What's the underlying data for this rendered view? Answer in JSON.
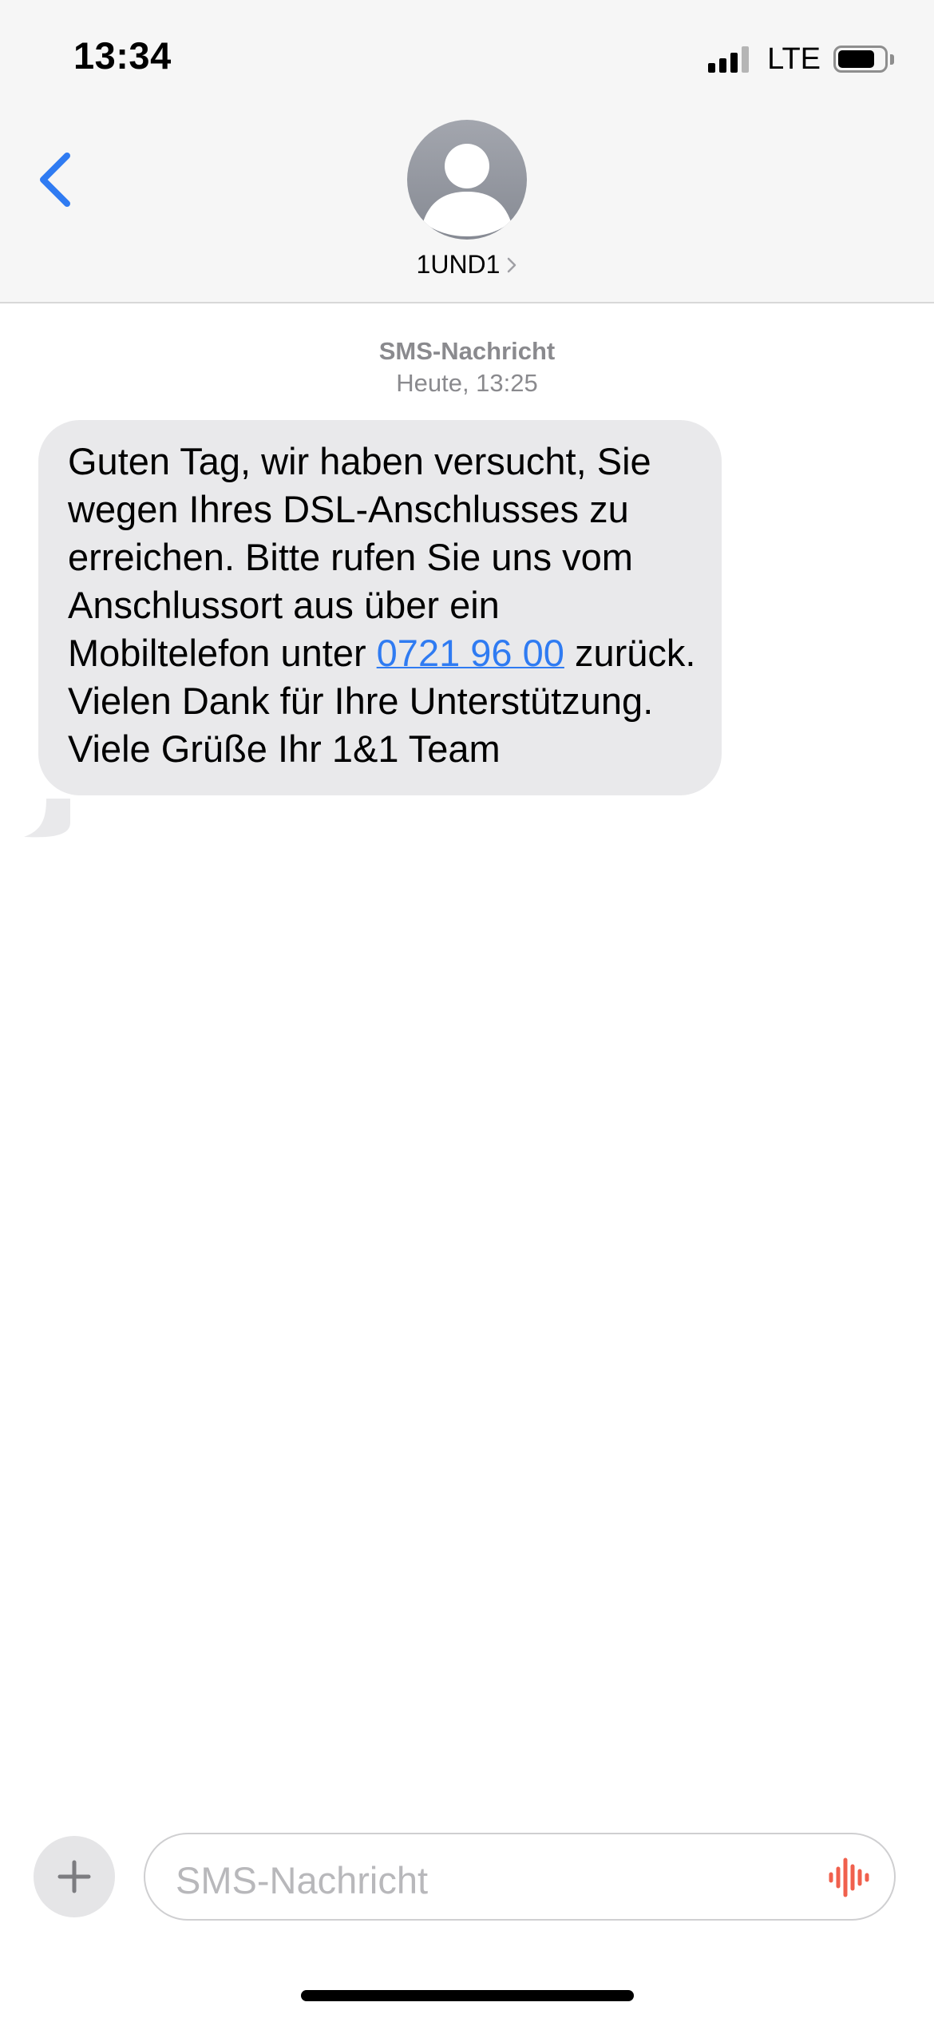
{
  "status_bar": {
    "time": "13:34",
    "network": "LTE",
    "signal_bars_active": 3,
    "signal_bars_total": 4,
    "battery_level": 0.8
  },
  "header": {
    "contact_name": "1UND1",
    "icons": {
      "back": "chevron-left-icon",
      "avatar": "person-icon",
      "details": "chevron-right-icon"
    }
  },
  "conversation": {
    "service_label": "SMS-Nachricht",
    "timestamp": "Heute, 13:25",
    "messages": [
      {
        "direction": "incoming",
        "text_before_link": "Guten Tag, wir haben versucht, Sie wegen Ihres DSL-Anschlusses zu erreichen. Bitte rufen Sie uns vom Anschlussort aus über ein Mobiltelefon unter ",
        "link_text": "0721 96 00",
        "text_after_link": " zurück. Vielen Dank für Ihre Unterstützung. Viele Grüße Ihr 1&1 Team"
      }
    ]
  },
  "composer": {
    "placeholder": "SMS-Nachricht",
    "icons": {
      "add": "plus-icon",
      "voice": "waveform-icon"
    }
  },
  "colors": {
    "accent": "#2f7bf2",
    "bubble_incoming": "#e9e9eb",
    "header_background": "#f6f6f6",
    "voice_icon": "#f0604d",
    "meta_text": "#8a8a8e"
  }
}
